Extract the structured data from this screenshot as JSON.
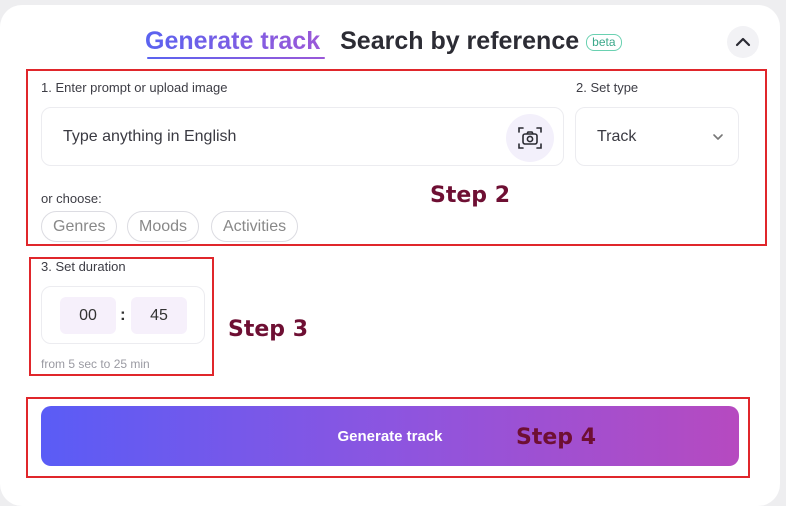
{
  "tabs": {
    "active": "Generate track",
    "inactive": "Search by reference",
    "badge": "beta"
  },
  "prompt": {
    "label": "1. Enter prompt or upload image",
    "placeholder": "Type anything in English"
  },
  "type": {
    "label": "2. Set type",
    "value": "Track"
  },
  "choose": {
    "label": "or choose:",
    "chips": [
      "Genres",
      "Moods",
      "Activities"
    ]
  },
  "duration": {
    "label": "3. Set duration",
    "minutes": "00",
    "separator": ":",
    "seconds": "45",
    "hint": "from 5 sec to 25 min"
  },
  "action": {
    "button": "Generate track"
  },
  "annotations": {
    "step2": "Step 2",
    "step3": "Step 3",
    "step4": "Step 4",
    "color": "#e0262b"
  },
  "colors": {
    "accent_start": "#5a5cf6",
    "accent_end": "#b64ac0",
    "step_text": "#6e0f33"
  }
}
